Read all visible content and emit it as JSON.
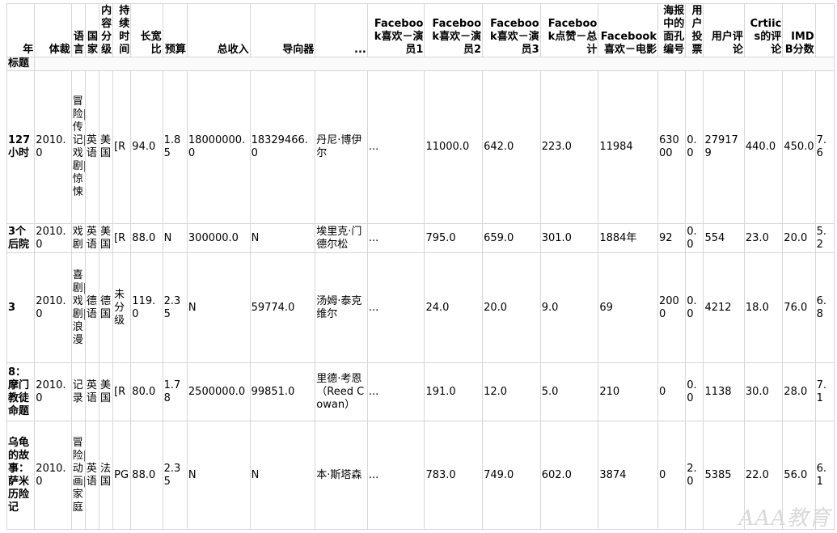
{
  "header": {
    "index_label": "年",
    "columns": [
      "体裁",
      "语言",
      "国家",
      "内容分级",
      "持续时间",
      "长宽比",
      "预算",
      "总收入",
      "导向器",
      "...",
      "Facebook喜欢－演员1",
      "Facebook喜欢－演员2",
      "Facebook喜欢－演员3",
      "Facebook点赞－总计",
      "Facebook喜欢－电影",
      "海报中的面孔编号",
      "用户投票",
      "用户评论",
      "Crtiics的评论",
      "IMDB分数",
      ""
    ]
  },
  "index_name": "标题",
  "rows": [
    {
      "title": "127小时",
      "cells": [
        "2010.0",
        "冒险|传记|戏剧|惊悚",
        "英语",
        "美国",
        "[R",
        "94.0",
        "1.85",
        "18000000.0",
        "18329466.0",
        "丹尼·博伊尔",
        "...",
        "11000.0",
        "642.0",
        "223.0",
        "11984",
        "63000",
        "0.0",
        "279179",
        "440.0",
        "450.0",
        "7.6"
      ]
    },
    {
      "title": "3个后院",
      "cells": [
        "2010.0",
        "戏剧",
        "英语",
        "美国",
        "[R",
        "88.0",
        "N",
        "300000.0",
        "N",
        "埃里克·门德尔松",
        "...",
        "795.0",
        "659.0",
        "301.0",
        "1884年",
        "92",
        "0.0",
        "554",
        "23.0",
        "20.0",
        "5.2"
      ]
    },
    {
      "title": "3",
      "cells": [
        "2010.0",
        "喜剧|戏剧|浪漫",
        "德语",
        "德国",
        "未分级",
        "119.0",
        "2.35",
        "N",
        "59774.0",
        "汤姆·泰克维尔",
        "...",
        "24.0",
        "20.0",
        "9.0",
        "69",
        "2000",
        "0.0",
        "4212",
        "18.0",
        "76.0",
        "6.8"
      ]
    },
    {
      "title": "8：摩门教徒命题",
      "cells": [
        "2010.0",
        "记录",
        "英语",
        "美国",
        "[R",
        "80.0",
        "1.78",
        "2500000.0",
        "99851.0",
        "里德·考恩（Reed Cowan）",
        "...",
        "191.0",
        "12.0",
        "5.0",
        "210",
        "0",
        "0.0",
        "1138",
        "30.0",
        "28.0",
        "7.1"
      ]
    },
    {
      "title": "乌龟的故事：萨米历险记",
      "cells": [
        "2010.0",
        "冒险|动画|家庭",
        "英语",
        "法国",
        "PG",
        "88.0",
        "2.35",
        "N",
        "N",
        "本·斯塔森",
        "...",
        "783.0",
        "749.0",
        "602.0",
        "3874",
        "0",
        "2.0",
        "5385",
        "22.0",
        "56.0",
        "6.1"
      ]
    }
  ],
  "watermark": "AAA教育"
}
